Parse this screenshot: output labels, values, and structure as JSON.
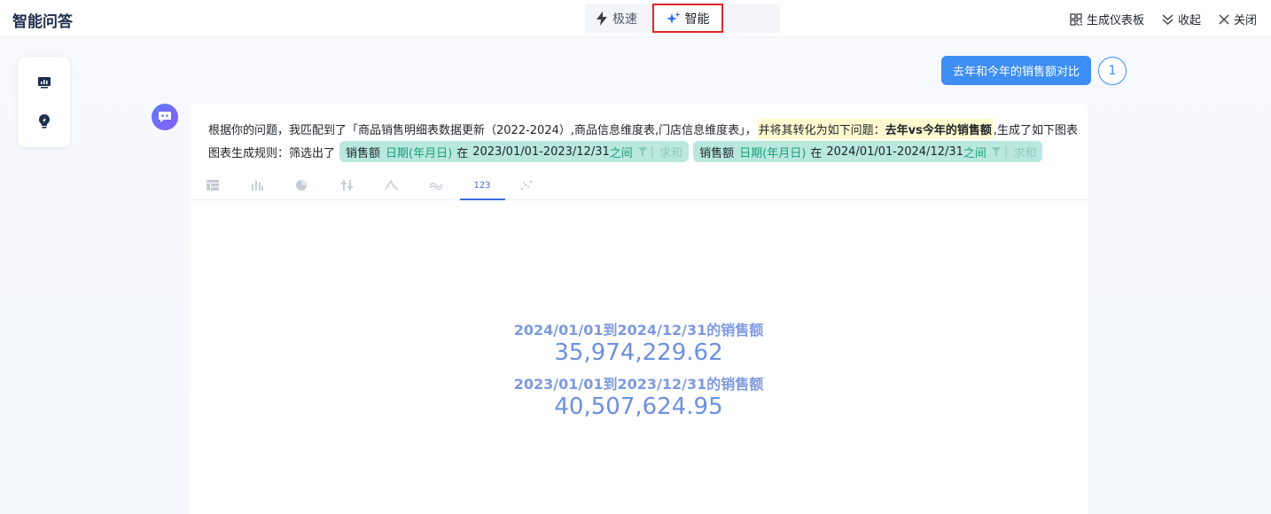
{
  "header": {
    "title": "智能问答",
    "modes": {
      "fast": "极速",
      "smart": "智能"
    },
    "actions": {
      "dashboard": "生成仪表板",
      "collapse": "收起",
      "close": "关闭"
    }
  },
  "question": {
    "text": "去年和今年的销售额对比",
    "user_badge": "1"
  },
  "answer": {
    "line1_prefix": "根据你的问题，我匹配到了「商品销售明细表数据更新（2022-2024）,商品信息维度表,门店信息维度表」，",
    "line1_hl_prefix": "并将其转化为如下问题：",
    "line1_hl_bold": "去年vs今年的销售额",
    "line1_suffix": ",生成了如下图表",
    "line2_prefix": "图表生成规则：筛选出了",
    "rules": [
      {
        "measure": "销售额",
        "field": "日期(年月日)",
        "op": "在",
        "range": "2023/01/01-2023/12/31",
        "tail": "之间",
        "sep": "|",
        "agg": "求和"
      },
      {
        "measure": "销售额",
        "field": "日期(年月日)",
        "op": "在",
        "range": "2024/01/01-2024/12/31",
        "tail": "之间",
        "sep": "|",
        "agg": "求和"
      }
    ],
    "chart_tabs": [
      "table-icon",
      "bar-chart-icon",
      "pie-chart-icon",
      "scatter-bar-icon",
      "line-chart-icon",
      "area-chart-icon",
      "kpi-number",
      "scatter-icon"
    ],
    "kpi_tab_label": "123",
    "kpis": [
      {
        "label": "2024/01/01到2024/12/31的销售额",
        "value": "35,974,229.62"
      },
      {
        "label": "2023/01/01到2023/12/31的销售额",
        "value": "40,507,624.95"
      }
    ]
  },
  "colors": {
    "accent": "#3d8ef5",
    "highlight_border": "#e0262b",
    "chip_bg": "#b9e8df",
    "kpi": "#6c8fe0"
  }
}
